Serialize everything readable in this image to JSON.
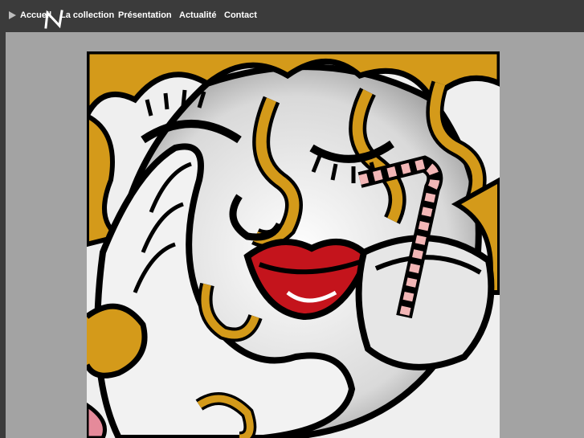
{
  "nav": {
    "arrow_icon": "play-arrow-icon",
    "items": [
      {
        "label": "Accueil",
        "active": true
      },
      {
        "label": "La collection",
        "active": false
      },
      {
        "label": "Présentation",
        "active": false
      },
      {
        "label": "Actualité",
        "active": false
      },
      {
        "label": "Contact",
        "active": false
      }
    ]
  },
  "logo": {
    "icon": "n-logo-icon"
  },
  "artwork": {
    "icon": "pop-art-painting-image"
  },
  "colors": {
    "nav_background": "#3b3b3b",
    "page_background": "#a3a3a3",
    "nav_text": "#ffffff",
    "hair_gold": "#d49a1a",
    "lips_red": "#c4141c"
  }
}
